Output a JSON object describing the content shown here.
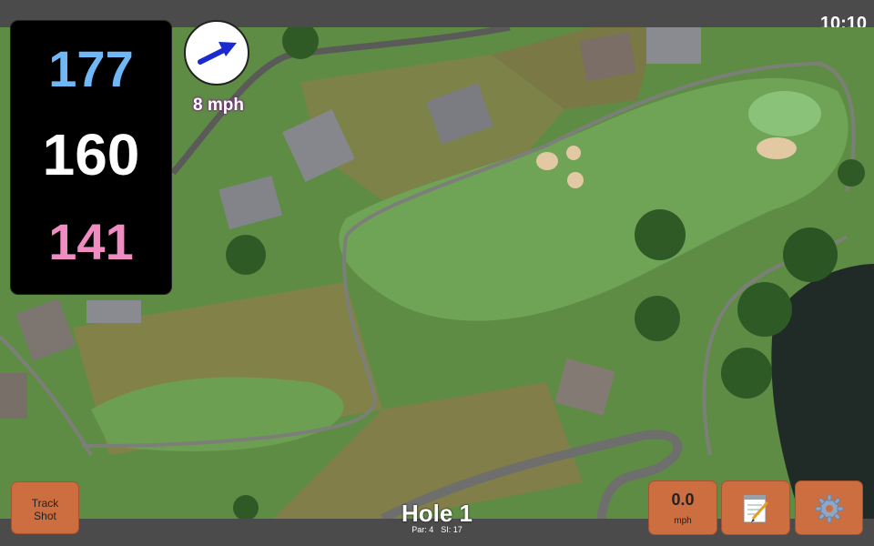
{
  "status": {
    "time": "10:10"
  },
  "distances": {
    "back": "177",
    "middle": "160",
    "front": "141"
  },
  "wind": {
    "speed": "8 mph",
    "direction_icon": "arrow-right-icon"
  },
  "hole": {
    "title": "Hole 1",
    "par": "Par: 4",
    "si": "SI: 17"
  },
  "buttons": {
    "track_shot_line1": "Track",
    "track_shot_line2": "Shot",
    "speed_value": "0.0",
    "speed_unit": "mph",
    "notes_icon": "notepad-icon",
    "settings_icon": "gear-icon"
  },
  "colors": {
    "back": "#6fb7f5",
    "middle": "#ffffff",
    "front": "#f08cc2",
    "button": "#cd6e40"
  }
}
